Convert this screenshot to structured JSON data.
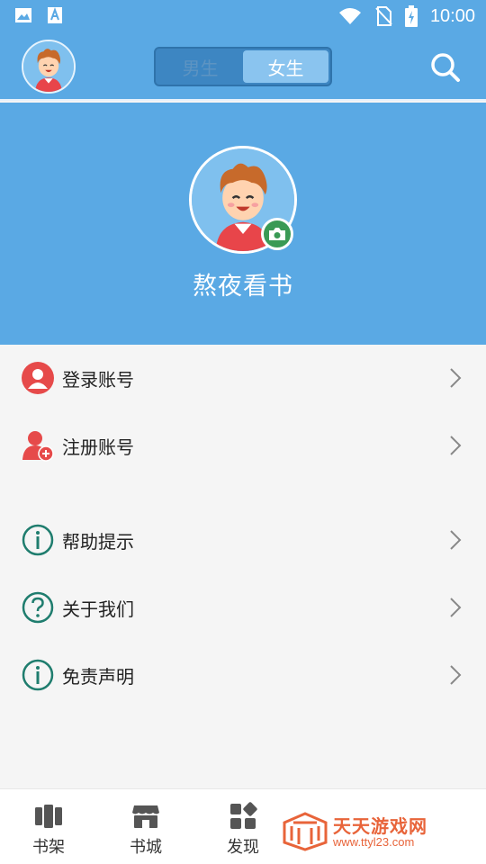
{
  "status_bar": {
    "time": "10:00",
    "icons": [
      "image-icon",
      "text-a-icon",
      "wifi-icon",
      "no-sim-icon",
      "battery-charging-icon"
    ]
  },
  "header": {
    "avatar_icon": "avatar-boy-icon",
    "gender_tabs": [
      {
        "label": "男生",
        "selected": false
      },
      {
        "label": "女生",
        "selected": true
      }
    ],
    "search_icon": "search-icon"
  },
  "profile": {
    "name": "熬夜看书",
    "camera_icon": "camera-icon"
  },
  "menu": {
    "items": [
      {
        "label": "登录账号",
        "icon": "user-icon"
      },
      {
        "label": "注册账号",
        "icon": "add-user-icon"
      },
      {
        "label": "帮助提示",
        "icon": "info-icon"
      },
      {
        "label": "关于我们",
        "icon": "question-icon"
      },
      {
        "label": "免责声明",
        "icon": "info-icon"
      }
    ]
  },
  "tabbar": {
    "tabs": [
      {
        "label": "书架",
        "icon": "bookshelf-icon"
      },
      {
        "label": "书城",
        "icon": "store-icon"
      },
      {
        "label": "发现",
        "icon": "discover-icon"
      }
    ]
  },
  "watermark": {
    "name": "天天游戏网",
    "url": "www.ttyl23.com"
  },
  "colors": {
    "primary": "#5aa9e4",
    "menu_icon_red": "#e64a4a",
    "menu_icon_teal": "#1f7d6e",
    "camera_green": "#3a9a55",
    "watermark_orange": "#e8643a"
  }
}
